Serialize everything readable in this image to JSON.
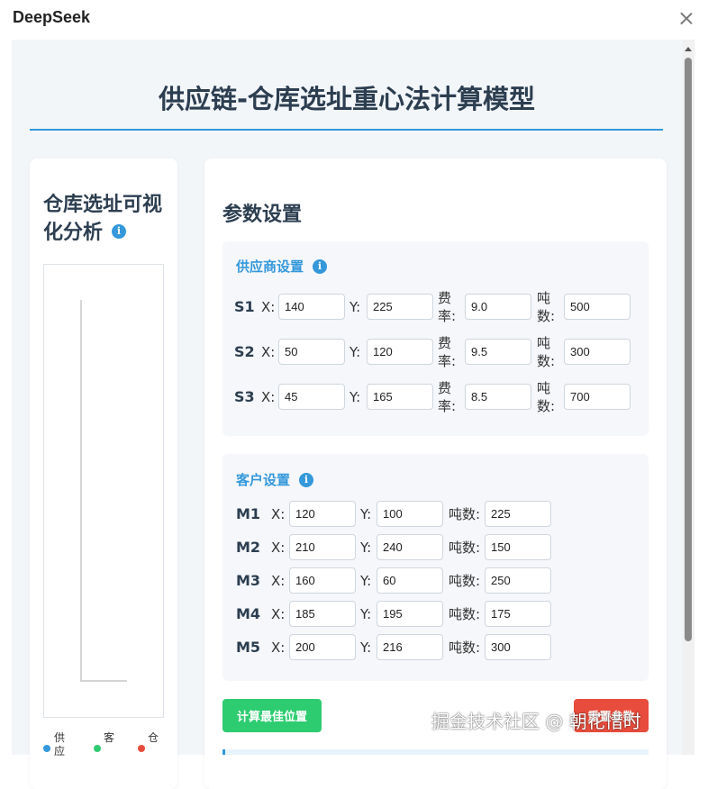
{
  "window": {
    "app_title": "DeepSeek"
  },
  "page": {
    "title": "供应链-仓库选址重心法计算模型"
  },
  "visualization": {
    "title": "仓库选址可视化分析",
    "legend": [
      {
        "label": "供应",
        "color": "#3498db"
      },
      {
        "label": "客",
        "color": "#2ecc71"
      },
      {
        "label": "仓",
        "color": "#e74c3c"
      }
    ]
  },
  "params": {
    "title": "参数设置",
    "labels": {
      "x": "X:",
      "y": "Y:",
      "rate": "费率:",
      "tons": "吨数:"
    },
    "suppliers": {
      "title": "供应商设置",
      "rows": [
        {
          "id": "S1",
          "x": "140",
          "y": "225",
          "rate": "9.0",
          "tons": "500"
        },
        {
          "id": "S2",
          "x": "50",
          "y": "120",
          "rate": "9.5",
          "tons": "300"
        },
        {
          "id": "S3",
          "x": "45",
          "y": "165",
          "rate": "8.5",
          "tons": "700"
        }
      ]
    },
    "customers": {
      "title": "客户设置",
      "rows": [
        {
          "id": "M1",
          "x": "120",
          "y": "100",
          "tons": "225"
        },
        {
          "id": "M2",
          "x": "210",
          "y": "240",
          "tons": "150"
        },
        {
          "id": "M3",
          "x": "160",
          "y": "60",
          "tons": "250"
        },
        {
          "id": "M4",
          "x": "185",
          "y": "195",
          "tons": "175"
        },
        {
          "id": "M5",
          "x": "200",
          "y": "216",
          "tons": "300"
        }
      ]
    }
  },
  "buttons": {
    "calculate": "计算最佳位置",
    "reset": "重置参数"
  },
  "watermark": "掘金技术社区 @ 朝花惜时"
}
